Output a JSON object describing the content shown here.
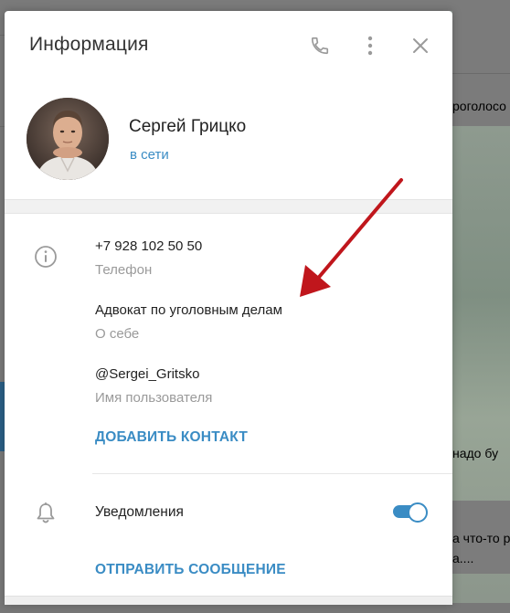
{
  "background": {
    "snippets": [
      "роголосо",
      "надо бу",
      "а что-то р",
      "а...."
    ]
  },
  "dialog": {
    "title": "Информация",
    "header_icons": [
      "phone-icon",
      "more-vertical-icon",
      "close-icon"
    ]
  },
  "profile": {
    "name": "Сергей Грицко",
    "status": "в сети"
  },
  "fields": {
    "phone": {
      "value": "+7 928 102 50 50",
      "label": "Телефон"
    },
    "about": {
      "value": "Адвокат по уголовным делам",
      "label": "О себе"
    },
    "username": {
      "value": "@Sergei_Gritsko",
      "label": "Имя пользователя"
    }
  },
  "actions": {
    "add_contact": "ДОБАВИТЬ КОНТАКТ",
    "send_message": "ОТПРАВИТЬ СООБЩЕНИЕ"
  },
  "notifications": {
    "label": "Уведомления",
    "enabled": true
  },
  "colors": {
    "accent": "#3a8cc4",
    "annotation_arrow": "#c0161c"
  }
}
